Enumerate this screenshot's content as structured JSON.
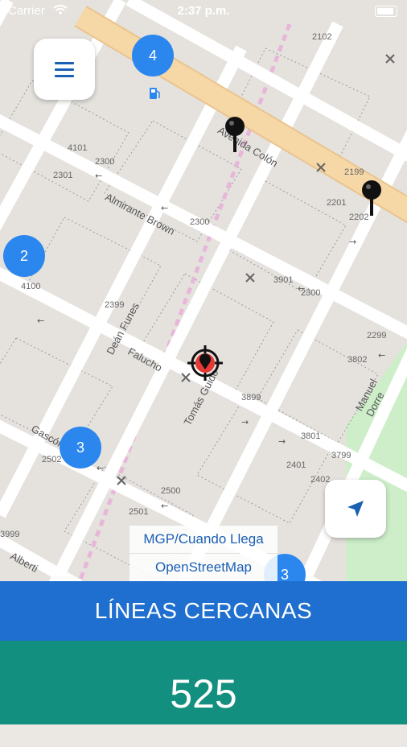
{
  "status_bar": {
    "carrier": "Carrier",
    "time": "2:37 p.m."
  },
  "map": {
    "street_labels": {
      "avenida_colon": "Avenida Colón",
      "almirante_brown": "Almirante Brown",
      "dean_funes": "Deán Funes",
      "falucho": "Falucho",
      "tomas_guido": "Tomás Guido",
      "manuel_dorrego": "Manuel Dorre",
      "gascon": "Gascón",
      "alberti": "Alberti"
    },
    "house_numbers": [
      "2102",
      "2199",
      "2201",
      "2202",
      "4101",
      "2300",
      "2301",
      "2300",
      "4100",
      "3901",
      "2300",
      "2399",
      "2299",
      "3802",
      "3899",
      "3801",
      "3799",
      "2401",
      "2402",
      "2501",
      "2500",
      "3999",
      "2502"
    ],
    "clusters": [
      {
        "count": "4"
      },
      {
        "count": "2"
      },
      {
        "count": "3"
      },
      {
        "count": "3"
      }
    ],
    "attribution": {
      "primary": "MGP/Cuando Llega",
      "secondary": "OpenStreetMap"
    }
  },
  "menu_button": {
    "icon": "hamburger-menu-icon"
  },
  "locate_button": {
    "icon": "location-arrow-icon"
  },
  "banner": {
    "title": "LÍNEAS CERCANAS"
  },
  "route_panel": {
    "line_number": "525"
  },
  "colors": {
    "accent": "#2b87ee",
    "banner": "#1e6fcf",
    "route_panel": "#138f7f",
    "avenue": "#f6d7a6",
    "park": "#cdeec9"
  }
}
